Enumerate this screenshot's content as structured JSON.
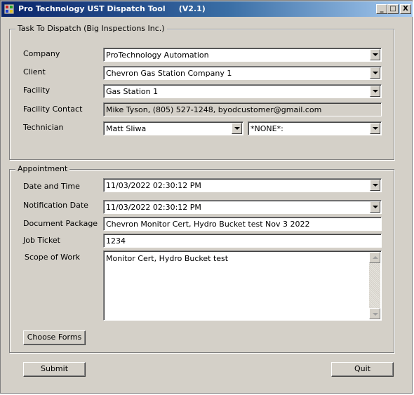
{
  "window": {
    "title": "Pro Technology UST Dispatch Tool     (V2.1)",
    "controls": {
      "minimize": "_",
      "maximize": "□",
      "close": "X"
    }
  },
  "task_group": {
    "title": "Task To Dispatch (Big Inspections Inc.)",
    "company_label": "Company",
    "company_value": "ProTechnology Automation",
    "client_label": "Client",
    "client_value": "Chevron Gas Station Company 1",
    "facility_label": "Facility",
    "facility_value": "Gas Station 1",
    "facility_contact_label": "Facility Contact",
    "facility_contact_value": "Mike Tyson, (805) 527-1248, byodcustomer@gmail.com",
    "technician_label": "Technician",
    "technician_value": "Matt Sliwa",
    "technician2_value": "*NONE*:"
  },
  "appointment_group": {
    "title": "Appointment",
    "date_time_label": "Date and Time",
    "date_time_value": "11/03/2022 02:30:12 PM",
    "notification_label": "Notification Date",
    "notification_value": "11/03/2022 02:30:12 PM",
    "document_package_label": "Document Package",
    "document_package_value": "Chevron Monitor Cert, Hydro Bucket test Nov 3 2022",
    "job_ticket_label": "Job Ticket",
    "job_ticket_value": "1234",
    "scope_label": "Scope of Work",
    "scope_value": "Monitor Cert, Hydro Bucket test",
    "choose_forms_label": "Choose Forms"
  },
  "footer": {
    "submit_label": "Submit",
    "quit_label": "Quit"
  },
  "colors": {
    "face": "#d4d0c8",
    "title_start": "#0a246a",
    "title_end": "#a6caf0"
  }
}
